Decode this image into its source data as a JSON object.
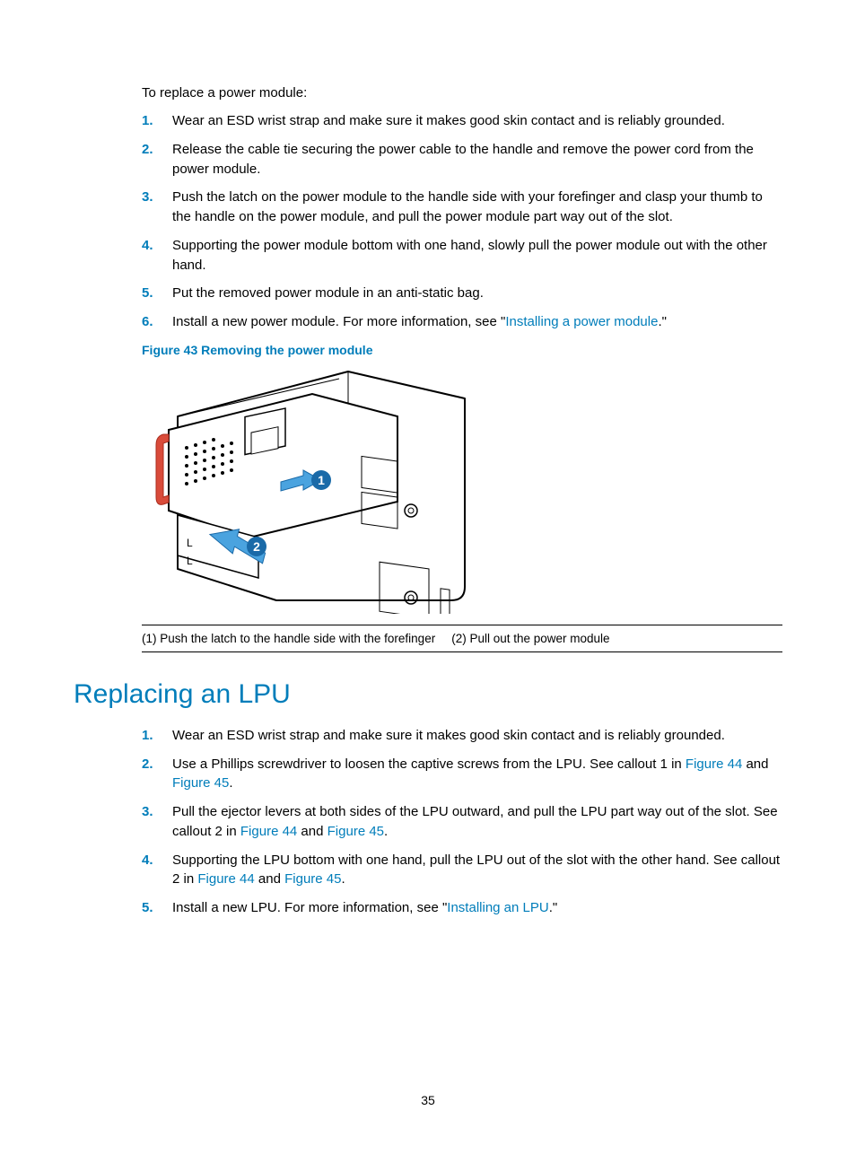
{
  "intro": "To replace a power module:",
  "steps1": [
    {
      "num": "1.",
      "text": "Wear an ESD wrist strap and make sure it makes good skin contact and is reliably grounded."
    },
    {
      "num": "2.",
      "text": "Release the cable tie securing the power cable to the handle and remove the power cord from the power module."
    },
    {
      "num": "3.",
      "text": "Push the latch on the power module to the handle side with your forefinger and clasp your thumb to the handle on the power module, and pull the power module part way out of the slot."
    },
    {
      "num": "4.",
      "text": "Supporting the power module bottom with one hand, slowly pull the power module out with the other hand."
    },
    {
      "num": "5.",
      "text": "Put the removed power module in an anti-static bag."
    },
    {
      "num": "6.",
      "prefix": "Install a new power module. For more information, see \"",
      "link": "Installing a power module",
      "suffix": ".\""
    }
  ],
  "figure43_caption": "Figure 43 Removing the power module",
  "callout1": "(1) Push the latch to the handle side with the forefinger",
  "callout2": "(2) Pull out the power module",
  "section_heading": "Replacing an LPU",
  "steps2": [
    {
      "num": "1.",
      "parts": [
        {
          "t": "Wear an ESD wrist strap and make sure it makes good skin contact and is reliably grounded."
        }
      ]
    },
    {
      "num": "2.",
      "parts": [
        {
          "t": "Use a Phillips screwdriver to loosen the captive screws from the LPU. See callout 1 in "
        },
        {
          "l": "Figure 44"
        },
        {
          "t": " and "
        },
        {
          "l": "Figure 45"
        },
        {
          "t": "."
        }
      ]
    },
    {
      "num": "3.",
      "parts": [
        {
          "t": "Pull the ejector levers at both sides of the LPU outward, and pull the LPU part way out of the slot. See callout 2 in "
        },
        {
          "l": "Figure 44"
        },
        {
          "t": " and "
        },
        {
          "l": "Figure 45"
        },
        {
          "t": "."
        }
      ]
    },
    {
      "num": "4.",
      "parts": [
        {
          "t": "Supporting the LPU bottom with one hand, pull the LPU out of the slot with the other hand. See callout 2 in "
        },
        {
          "l": "Figure 44"
        },
        {
          "t": " and "
        },
        {
          "l": "Figure 45"
        },
        {
          "t": "."
        }
      ]
    },
    {
      "num": "5.",
      "parts": [
        {
          "t": "Install a new LPU. For more information, see \""
        },
        {
          "l": "Installing an LPU"
        },
        {
          "t": ".\""
        }
      ]
    }
  ],
  "page_number": "35"
}
